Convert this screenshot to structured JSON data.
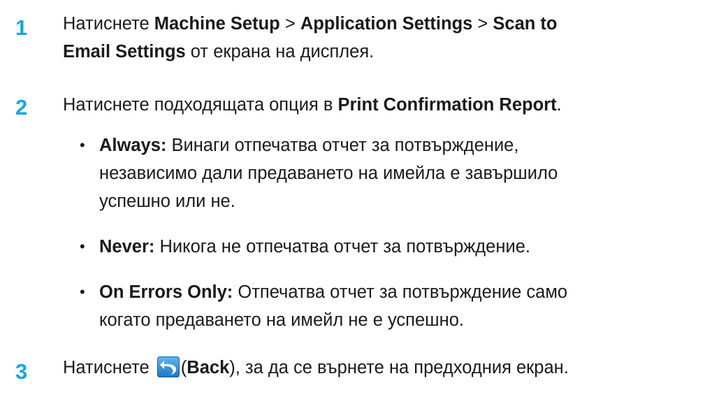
{
  "steps": [
    {
      "number": "1",
      "line1_pre": "Натиснете ",
      "menu_1": "Machine Setup",
      "sep_1": " > ",
      "menu_2": "Application Settings",
      "sep_2": " > ",
      "menu_3_a": "Scan to",
      "menu_3_b": "Email Settings",
      "line2_post": " от екрана на дисплея."
    },
    {
      "number": "2",
      "pre": "Натиснете подходящата опция в ",
      "bold": "Print Confirmation Report",
      "post": "."
    },
    {
      "number": "3",
      "pre": "Натиснете ",
      "paren_open": "(",
      "bold": "Back",
      "post": "), за да се върнете на предходния екран.",
      "icon": "back-arrow-icon"
    }
  ],
  "options": [
    {
      "bullet": "•",
      "label": "Always:",
      "lines": [
        " Винаги отпечатва отчет за потвърждение,",
        "независимо дали предаването на имейла е завършило",
        "успешно или не."
      ]
    },
    {
      "bullet": "•",
      "label": "Never:",
      "lines": [
        " Никога не отпечатва отчет за потвърждение."
      ]
    },
    {
      "bullet": "•",
      "label": "On Errors Only:",
      "lines": [
        " Отпечатва отчет за потвърждение само",
        "когато предаването на имейл не е успешно."
      ]
    }
  ],
  "colors": {
    "step_number": "#14a6e0",
    "icon_bg": "#2f8fd6",
    "text": "#1a1a1a"
  }
}
